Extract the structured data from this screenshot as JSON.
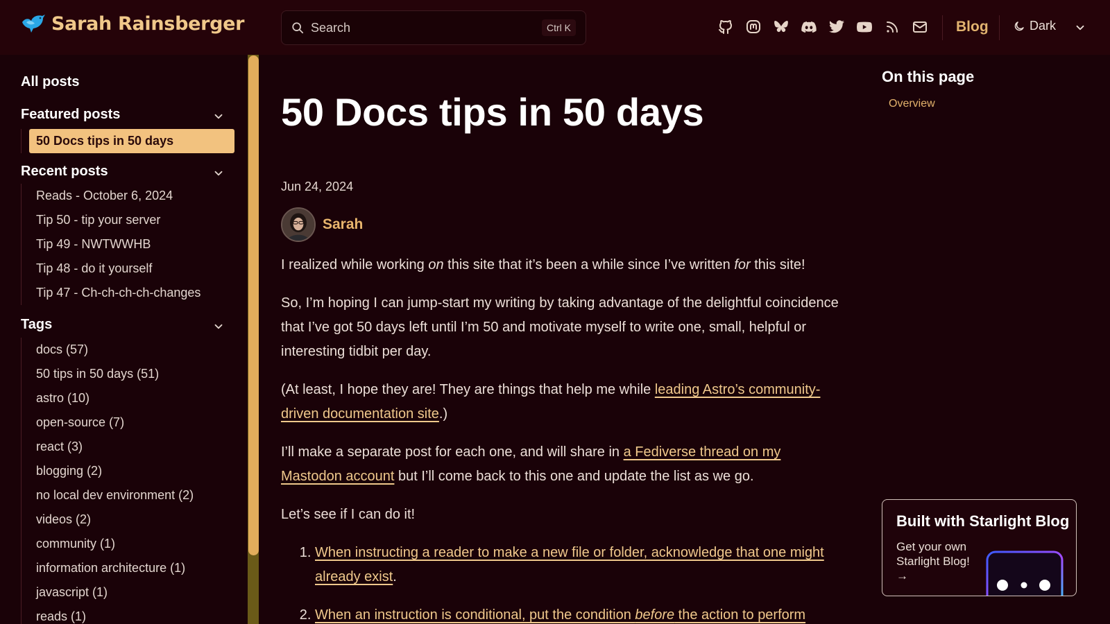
{
  "header": {
    "site_title": "Sarah Rainsberger",
    "search_placeholder": "Search",
    "search_shortcut": "Ctrl K",
    "social_icons": [
      "github-icon",
      "mastodon-icon",
      "bluesky-icon",
      "discord-icon",
      "twitter-icon",
      "youtube-icon",
      "rss-icon",
      "email-icon"
    ],
    "blog_label": "Blog",
    "theme_label": "Dark"
  },
  "sidebar": {
    "all_posts": "All posts",
    "featured": {
      "title": "Featured posts",
      "items": [
        "50 Docs tips in 50 days"
      ]
    },
    "recent": {
      "title": "Recent posts",
      "items": [
        "Reads - October 6, 2024",
        "Tip 50 - tip your server",
        "Tip 49 - NWTWWHB",
        "Tip 48 - do it yourself",
        "Tip 47 - Ch-ch-ch-ch-changes"
      ]
    },
    "tags": {
      "title": "Tags",
      "items": [
        "docs (57)",
        "50 tips in 50 days (51)",
        "astro (10)",
        "open-source (7)",
        "react (3)",
        "blogging (2)",
        "no local dev environment (2)",
        "videos (2)",
        "community (1)",
        "information architecture (1)",
        "javascript (1)",
        "reads (1)"
      ]
    }
  },
  "post": {
    "title": "50 Docs tips in 50 days",
    "date": "Jun 24, 2024",
    "author": "Sarah",
    "p1": {
      "a": "I realized while working ",
      "b": "on",
      "c": " this site that it’s been a while since I’ve written ",
      "d": "for",
      "e": " this site!"
    },
    "p2": "So, I’m hoping I can jump-start my writing by taking advantage of the delightful coincidence that I’ve got 50 days left until I’m 50 and motivate myself to write one, small, helpful or interesting tidbit per day.",
    "p3": {
      "a": "(At least, I hope they are! They are things that help me while ",
      "link": "leading Astro’s community-driven documentation site",
      "b": ".)"
    },
    "p4": {
      "a": "I’ll make a separate post for each one, and will share in ",
      "link": "a Fediverse thread on my Mastodon account",
      "b": " but I’ll come back to this one and update the list as we go."
    },
    "p5": "Let’s see if I can do it!",
    "list": {
      "item1": "When instructing a reader to make a new file or folder, acknowledge that one might already exist",
      "item1_end": ".",
      "item2_a": "When an instruction is conditional, put the condition ",
      "item2_b": "before",
      "item2_c": " the action to perform"
    }
  },
  "toc": {
    "title": "On this page",
    "items": [
      "Overview"
    ]
  },
  "promo": {
    "title": "Built with Starlight Blog",
    "subtitle": "Get your own Starlight Blog! →"
  }
}
